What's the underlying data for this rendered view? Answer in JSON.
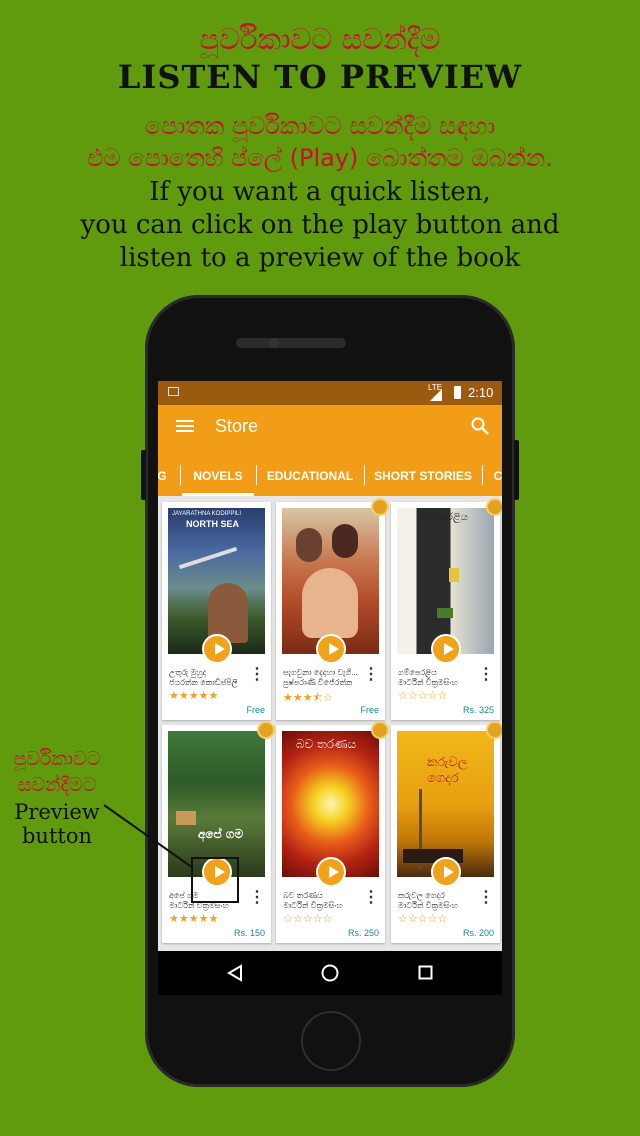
{
  "header": {
    "sinhala_title": "පූර්විකාවට සවන්දීම",
    "english_title": "LISTEN TO PREVIEW",
    "sinhala_line1": "පොතක පූර්විකාවට සවන්දීම සඳහා",
    "sinhala_line2": "එම පොතෙහි ප්ලේ (Play) බොත්තම ඔබන්න.",
    "english_line1": "If you want a quick listen,",
    "english_line2": "you can click on the play button and",
    "english_line3": "listen to a preview of the book"
  },
  "status_bar": {
    "network": "LTE",
    "time": "2:10"
  },
  "app_bar": {
    "title": "Store",
    "menu_icon": "hamburger-icon",
    "search_icon": "search-icon"
  },
  "tabs": [
    {
      "label": "G"
    },
    {
      "label": "NOVELS",
      "selected": true
    },
    {
      "label": "EDUCATIONAL"
    },
    {
      "label": "SHORT STORIES"
    },
    {
      "label": "C"
    }
  ],
  "books": [
    {
      "title": "උතුරු මුහුද",
      "author": "ජයරත්න කොඩිප්පිලි",
      "rating": 5,
      "price": "Free",
      "cover_title": "NORTH SEA",
      "cover_top": "JAYARATHNA KODIPPILI"
    },
    {
      "title": "සැගවුනා දෙදහා වැගි...",
      "author": "පුෂ්පරාණි විජේරත්න",
      "rating": 3.5,
      "price": "Free",
      "cover_title": "",
      "cover_top": ""
    },
    {
      "title": "ගම්පෙරළිය",
      "author": "මාර්ටින් වික්‍රමසිංහ",
      "rating": 0,
      "price": "Rs. 325",
      "cover_title": "ගම්පෙරළිය",
      "cover_top": ""
    },
    {
      "title": "අපේ ගම",
      "author": "මාර්ටින් වික්‍රමසිංහ",
      "rating": 5,
      "price": "Rs. 150",
      "cover_title": "අපේ ගම",
      "cover_top": ""
    },
    {
      "title": "බව තරණය",
      "author": "මාර්ටින් වික්‍රමසිංහ",
      "rating": 0,
      "price": "Rs. 250",
      "cover_title": "බව තරණය",
      "cover_top": ""
    },
    {
      "title": "කරුවල ගෙදර",
      "author": "මාර්ටින් වික්‍රමසිංහ",
      "rating": 0,
      "price": "Rs. 200",
      "cover_title": "කරුවල ගෙදර",
      "cover_top": ""
    }
  ],
  "annotation": {
    "line1": "පූර්විකාවට",
    "line2": "සවන්දීමට",
    "line3": "Preview",
    "line4": "button"
  },
  "colors": {
    "background": "#5f9b0c",
    "accent": "#f29d17",
    "status_bar": "#9c5a0e",
    "sinhala_text": "#c8102e",
    "star": "#f0a21a",
    "price": "#1a8a8a"
  }
}
